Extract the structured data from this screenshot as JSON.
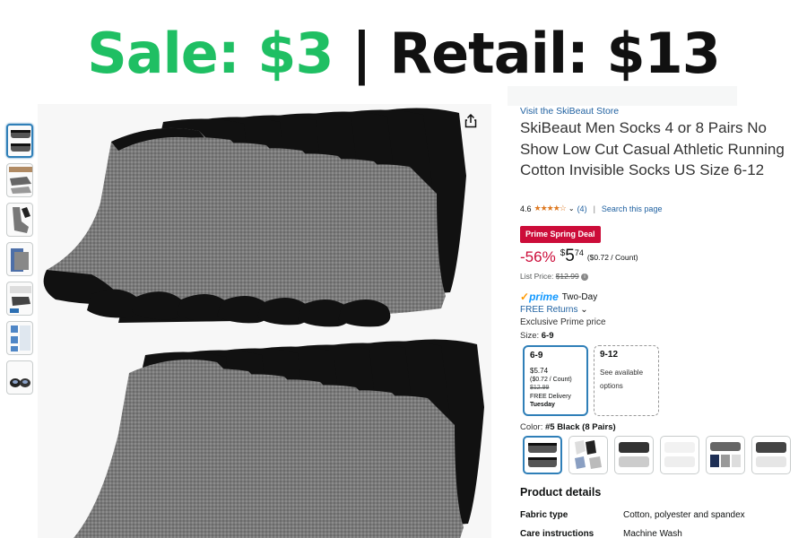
{
  "banner": {
    "sale": "Sale: $3",
    "separator": "|",
    "retail": "Retail: $13"
  },
  "thumbnails": [
    {
      "icon": "socks-pack-icon"
    },
    {
      "icon": "socks-worn-icon"
    },
    {
      "icon": "socks-worn-icon"
    },
    {
      "icon": "socks-size-icon"
    },
    {
      "icon": "socks-features-icon"
    },
    {
      "icon": "socks-care-icon"
    },
    {
      "icon": "socks-rolled-icon"
    }
  ],
  "product": {
    "store_link": "Visit the SkiBeaut Store",
    "title": "SkiBeaut Men Socks 4 or 8 Pairs No Show Low Cut Casual Athletic Running Cotton Invisible Socks US Size 6-12",
    "rating": "4.6",
    "stars": "★★★★☆",
    "rating_count": "(4)",
    "search_link": "Search this page",
    "deal_badge": "Prime Spring Deal",
    "discount": "-56%",
    "price_symbol": "$",
    "price_whole": "5",
    "price_cents": "74",
    "unit_price": "($0.72 / Count)",
    "list_price_label": "List Price:",
    "list_price": "$12.99",
    "prime_check": "✓",
    "prime_word": "prime",
    "prime_delivery": "Two-Day",
    "free_returns": "FREE Returns",
    "exclusive": "Exclusive Prime price",
    "size_label": "Size:",
    "size_selected": "6-9",
    "size_options": [
      {
        "size": "6-9",
        "price": "$5.74",
        "unit": "($0.72 / Count)",
        "list": "$12.99",
        "delivery": "FREE Delivery",
        "day": "Tuesday"
      },
      {
        "size": "9-12",
        "avail1": "See available",
        "avail2": "options"
      }
    ],
    "color_label": "Color:",
    "color_selected": "#5 Black (8 Pairs)",
    "details_title": "Product details",
    "details": [
      {
        "key": "Fabric type",
        "value": "Cotton, polyester and spandex"
      },
      {
        "key": "Care instructions",
        "value": "Machine Wash"
      }
    ]
  },
  "colors": {
    "sale_green": "#1fbf63",
    "link_blue": "#2162a1",
    "deal_red": "#cc0c39",
    "select_blue": "#2f7fb8"
  }
}
